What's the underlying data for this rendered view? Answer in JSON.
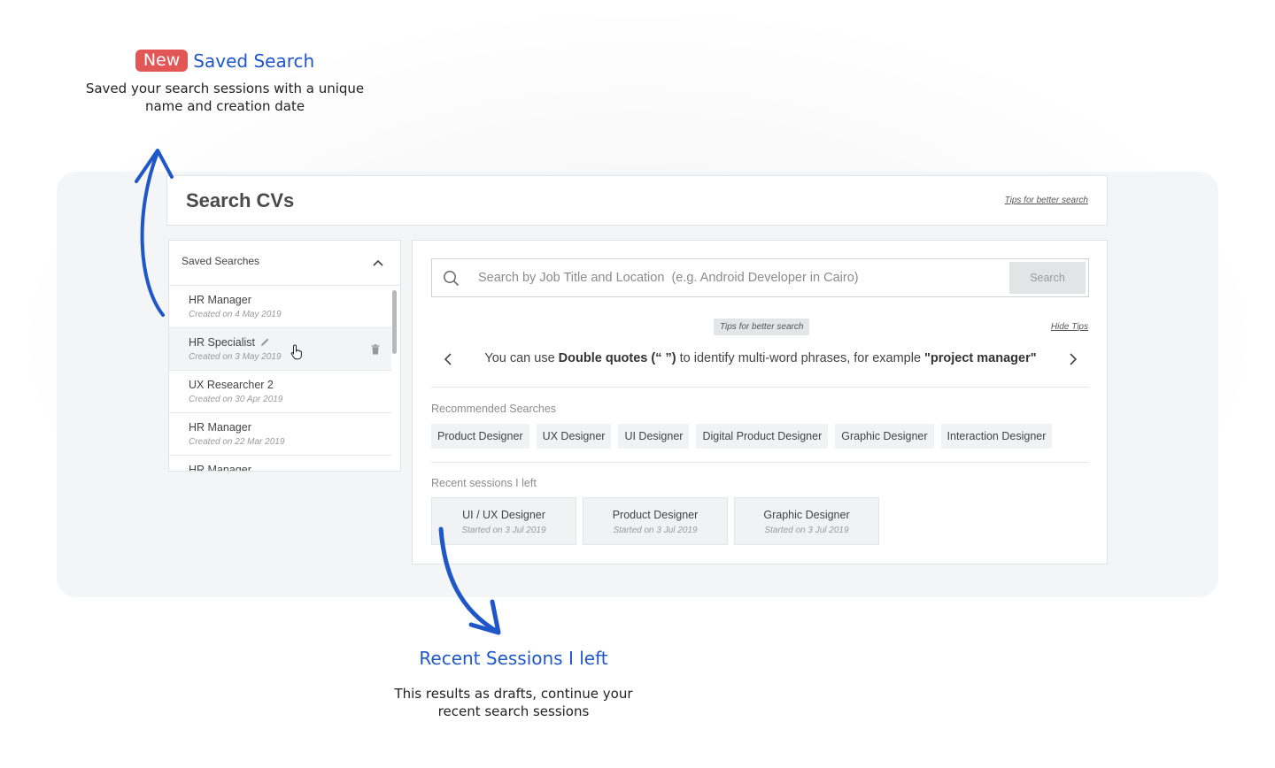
{
  "callouts": {
    "saved_search": {
      "badge": "New",
      "title": "Saved Search",
      "description": "Saved your search sessions with a unique name and creation date"
    },
    "recent_sessions": {
      "title": "Recent Sessions I left",
      "description": "This results as drafts, continue your recent search sessions"
    }
  },
  "header": {
    "title": "Search CVs",
    "tips_link": "Tips for better search"
  },
  "sidebar": {
    "title": "Saved Searches",
    "items": [
      {
        "name": "HR Manager",
        "date": "Created on 4 May 2019"
      },
      {
        "name": "HR Specialist",
        "date": "Created on 3 May 2019"
      },
      {
        "name": "UX Researcher 2",
        "date": "Created on 30 Apr 2019"
      },
      {
        "name": "HR Manager",
        "date": "Created on 22 Mar 2019"
      },
      {
        "name": "HR Manager",
        "date": ""
      }
    ]
  },
  "search": {
    "placeholder": "Search by Job Title and Location  (e.g. Android Developer in Cairo)",
    "value": "",
    "button_label": "Search"
  },
  "tips": {
    "badge": "Tips for better search",
    "hide_label": "Hide Tips",
    "text_prefix": "You can use ",
    "text_bold1": "Double quotes  (“ ”)",
    "text_middle": " to identify multi-word phrases, for example ",
    "text_bold2": "\"project manager\""
  },
  "recommended": {
    "label": "Recommended Searches",
    "chips": [
      "Product Designer",
      "UX Designer",
      "UI Designer",
      "Digital Product Designer",
      "Graphic Designer",
      "Interaction Designer"
    ]
  },
  "recent": {
    "label": "Recent sessions I left",
    "sessions": [
      {
        "name": "UI / UX Designer",
        "date": "Started on 3 Jul 2019"
      },
      {
        "name": "Product Designer",
        "date": "Started on 3 Jul 2019"
      },
      {
        "name": "Graphic Designer",
        "date": "Started on 3 Jul 2019"
      }
    ]
  },
  "colors": {
    "accent_blue": "#1f57c9",
    "badge_red": "#e25656",
    "panel_bg": "#f4f5f7"
  },
  "icons": [
    "search-icon",
    "chevron-up-icon",
    "chevron-left-icon",
    "chevron-right-icon",
    "pencil-icon",
    "trash-icon",
    "hand-cursor-icon",
    "curved-arrow-up-icon",
    "curved-arrow-down-icon"
  ]
}
